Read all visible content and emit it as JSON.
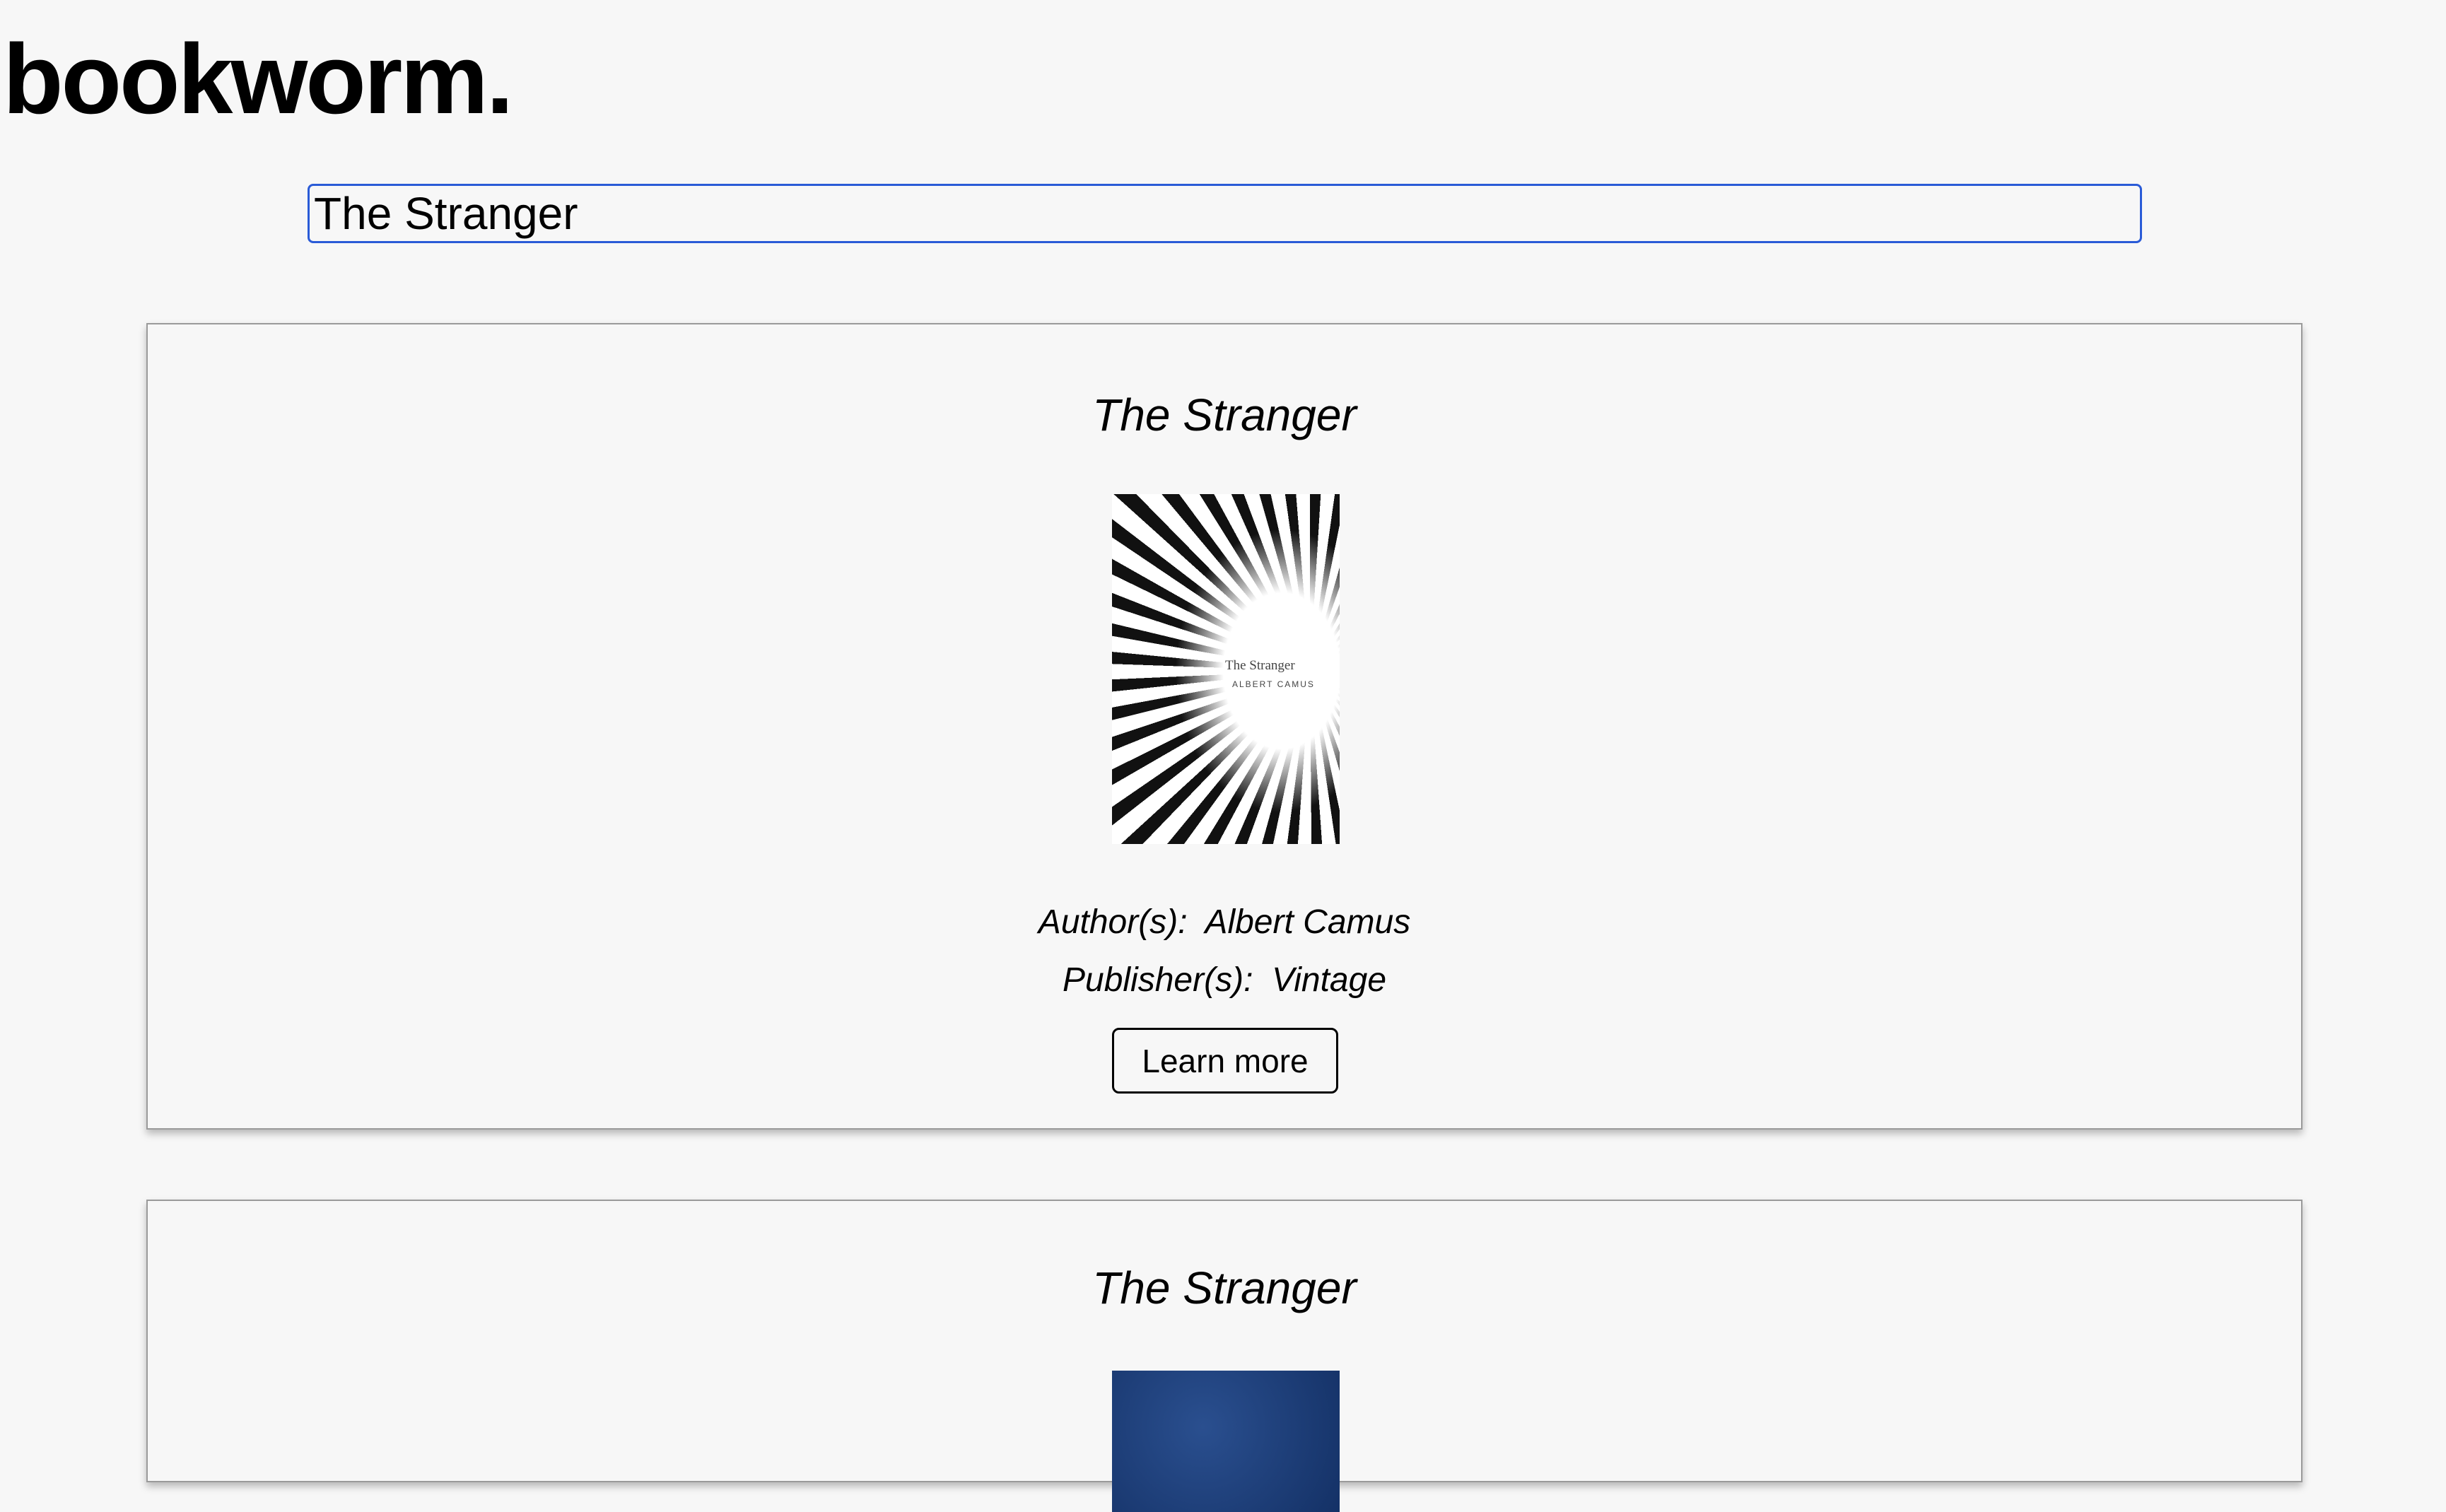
{
  "app": {
    "logo": "bookworm."
  },
  "search": {
    "value": "The Stranger"
  },
  "results": [
    {
      "title": "The Stranger",
      "cover_title": "The Stranger",
      "cover_author": "ALBERT CAMUS",
      "author_label": "Author(s):",
      "author": "Albert Camus",
      "publisher_label": "Publisher(s):",
      "publisher": "Vintage",
      "button": "Learn more"
    },
    {
      "title": "The Stranger"
    }
  ]
}
